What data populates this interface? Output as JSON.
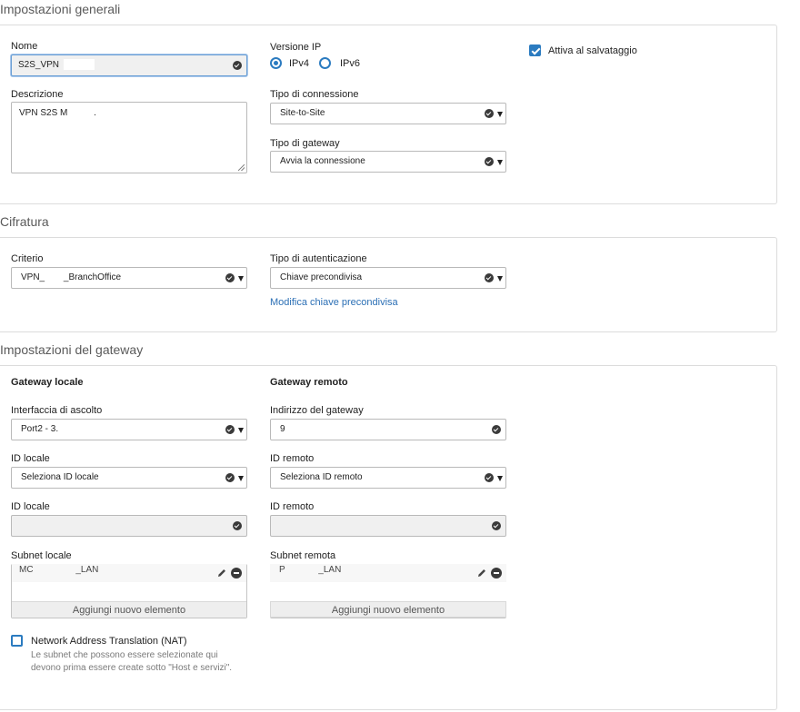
{
  "general": {
    "title": "Impostazioni generali",
    "name_label": "Nome",
    "name_value": "S2S_VPN",
    "description_label": "Descrizione",
    "description_value": "VPN S2S M",
    "ip_version_label": "Versione IP",
    "ipv4_label": "IPv4",
    "ipv6_label": "IPv6",
    "ip_version_selected": "IPv4",
    "activate_on_save_label": "Attiva al salvataggio",
    "activate_on_save_checked": true,
    "connection_type_label": "Tipo di connessione",
    "connection_type_value": "Site-to-Site",
    "gateway_type_label": "Tipo di gateway",
    "gateway_type_value": "Avvia la connessione"
  },
  "encryption": {
    "title": "Cifratura",
    "policy_label": "Criterio",
    "policy_value_a": "VPN_",
    "policy_value_b": "_BranchOffice",
    "auth_type_label": "Tipo di autenticazione",
    "auth_type_value": "Chiave precondivisa",
    "edit_psk_link": "Modifica chiave precondivisa"
  },
  "gateway": {
    "title": "Impostazioni del gateway",
    "local_heading": "Gateway locale",
    "remote_heading": "Gateway remoto",
    "listen_interface_label": "Interfaccia di ascolto",
    "listen_interface_value": "Port2 - 3.",
    "gateway_address_label": "Indirizzo del gateway",
    "gateway_address_value": "9",
    "local_id_label": "ID locale",
    "local_id_select_value": "Seleziona ID locale",
    "remote_id_label": "ID remoto",
    "remote_id_select_value": "Seleziona ID remoto",
    "local_id_label_2": "ID locale",
    "remote_id_label_2": "ID remoto",
    "local_subnet_label": "Subnet locale",
    "local_subnet_item_a": "MC",
    "local_subnet_item_b": "_LAN",
    "remote_subnet_label": "Subnet remota",
    "remote_subnet_item_a": "P",
    "remote_subnet_item_b": "_LAN",
    "add_item_label": "Aggiungi nuovo elemento",
    "nat_label": "Network Address Translation (NAT)",
    "nat_checked": false,
    "nat_note": "Le subnet che possono essere selezionate qui devono prima essere create sotto \"Host e servizi\"."
  },
  "colors": {
    "accent": "#2b7bc0",
    "link": "#2b6fb5"
  }
}
